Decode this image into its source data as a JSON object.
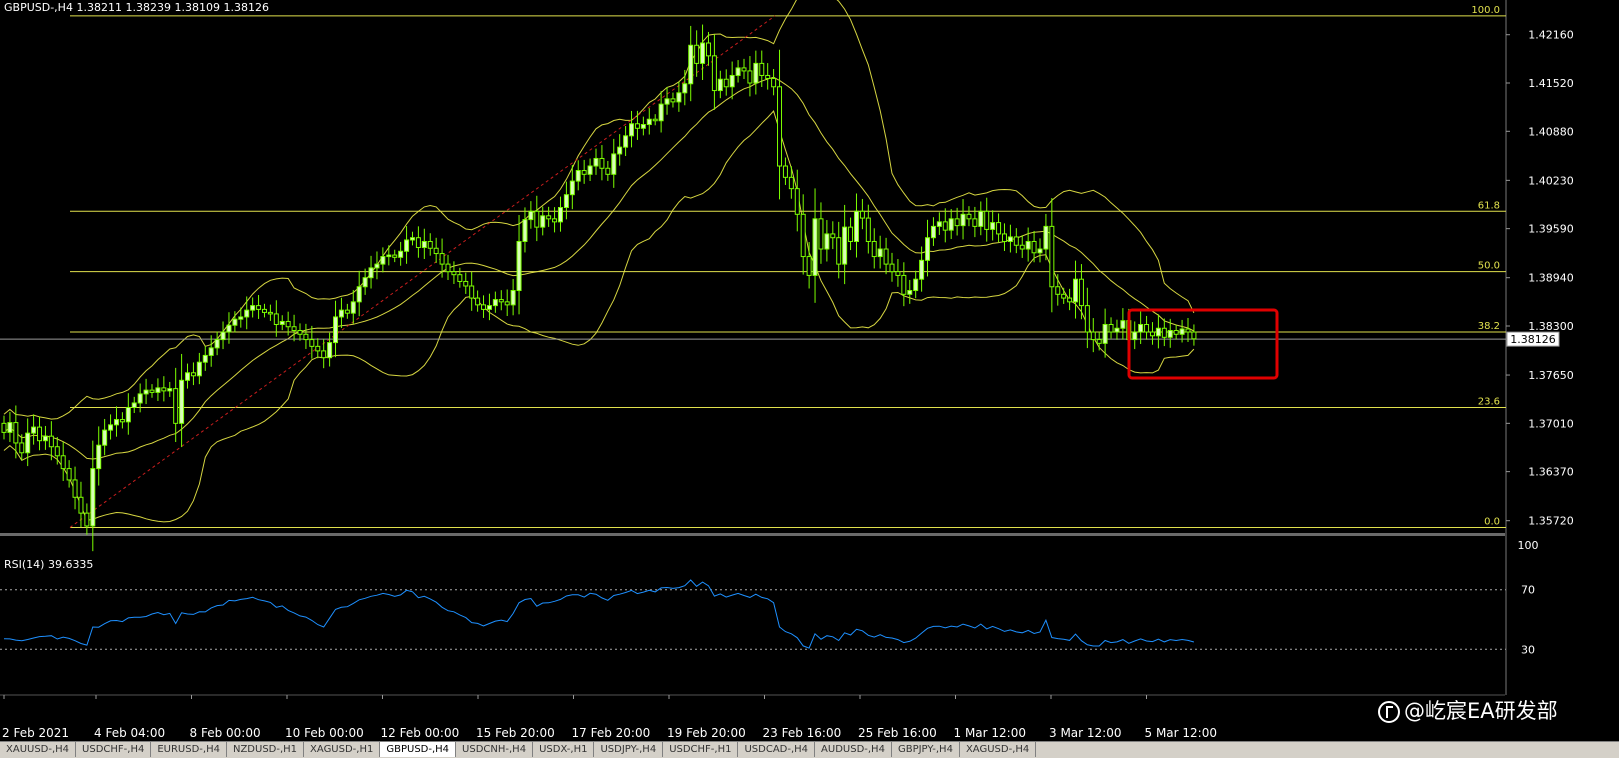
{
  "chart_data": {
    "type": "candlestick",
    "header": {
      "symbol": "GBPUSD-,H4",
      "open": "1.38211",
      "high": "1.38239",
      "low": "1.38109",
      "close": "1.38126"
    },
    "price_axis": {
      "ticks": [
        "1.42160",
        "1.41520",
        "1.40880",
        "1.40230",
        "1.39590",
        "1.38940",
        "1.38300",
        "1.37650",
        "1.37010",
        "1.36370",
        "1.35720"
      ],
      "range": [
        1.3557,
        1.4262
      ],
      "current_price_label": "1.38126"
    },
    "time_axis": {
      "labels": [
        "2 Feb 2021",
        "4 Feb 04:00",
        "8 Feb 00:00",
        "10 Feb 00:00",
        "12 Feb 00:00",
        "15 Feb 20:00",
        "17 Feb 20:00",
        "19 Feb 20:00",
        "23 Feb 16:00",
        "25 Feb 16:00",
        "1 Mar 12:00",
        "3 Mar 12:00",
        "5 Mar 12:00"
      ]
    },
    "fibonacci": [
      {
        "level": "100.0",
        "price": 1.4241
      },
      {
        "level": "61.8",
        "price": 1.3982
      },
      {
        "level": "50.0",
        "price": 1.3902
      },
      {
        "level": "38.2",
        "price": 1.3822
      },
      {
        "level": "23.6",
        "price": 1.3722
      },
      {
        "level": "0.0",
        "price": 1.3563
      }
    ],
    "closes": [
      1.3689,
      1.3702,
      1.3675,
      1.3662,
      1.3688,
      1.3696,
      1.3678,
      1.3684,
      1.367,
      1.3658,
      1.3641,
      1.3626,
      1.3603,
      1.3582,
      1.3565,
      1.3641,
      1.3672,
      1.3692,
      1.3699,
      1.3706,
      1.3703,
      1.3722,
      1.3728,
      1.374,
      1.3745,
      1.3742,
      1.3748,
      1.3744,
      1.3747,
      1.3701,
      1.3758,
      1.3768,
      1.3764,
      1.3782,
      1.3791,
      1.3801,
      1.3812,
      1.3822,
      1.3831,
      1.3839,
      1.3842,
      1.3851,
      1.3857,
      1.3852,
      1.3848,
      1.3846,
      1.3832,
      1.3836,
      1.3829,
      1.3824,
      1.3819,
      1.3812,
      1.3803,
      1.3797,
      1.3788,
      1.3808,
      1.3842,
      1.3851,
      1.3847,
      1.3862,
      1.3882,
      1.3894,
      1.3907,
      1.3912,
      1.3922,
      1.3924,
      1.3921,
      1.3929,
      1.3944,
      1.3947,
      1.3934,
      1.3942,
      1.3933,
      1.3926,
      1.3912,
      1.3902,
      1.3898,
      1.3889,
      1.3883,
      1.3867,
      1.3858,
      1.3852,
      1.3857,
      1.3865,
      1.3862,
      1.3858,
      1.3877,
      1.3942,
      1.3971,
      1.3982,
      1.3961,
      1.3976,
      1.3972,
      1.3968,
      1.3987,
      1.4004,
      1.4022,
      1.4036,
      1.4031,
      1.4042,
      1.4052,
      1.4039,
      1.4031,
      1.4058,
      1.4067,
      1.4082,
      1.4098,
      1.4092,
      1.4097,
      1.4104,
      1.4102,
      1.4124,
      1.4131,
      1.4127,
      1.4139,
      1.4151,
      1.4202,
      1.4178,
      1.4205,
      1.4188,
      1.4142,
      1.4157,
      1.4147,
      1.4162,
      1.4172,
      1.4168,
      1.4152,
      1.4178,
      1.4162,
      1.4158,
      1.4147,
      1.4042,
      1.4027,
      1.4012,
      1.3978,
      1.3922,
      1.3897,
      1.3972,
      1.3932,
      1.3952,
      1.3947,
      1.3912,
      1.3961,
      1.3942,
      1.3982,
      1.3973,
      1.3942,
      1.3922,
      1.3932,
      1.3912,
      1.3902,
      1.3897,
      1.3872,
      1.3877,
      1.3892,
      1.3917,
      1.3947,
      1.3962,
      1.3968,
      1.3957,
      1.3972,
      1.3963,
      1.3978,
      1.3972,
      1.3962,
      1.3982,
      1.3958,
      1.3967,
      1.3952,
      1.3942,
      1.3948,
      1.3937,
      1.3932,
      1.3942,
      1.3927,
      1.3932,
      1.3962,
      1.3882,
      1.3872,
      1.3867,
      1.3862,
      1.3892,
      1.3857,
      1.3822,
      1.3812,
      1.3807,
      1.3832,
      1.3822,
      1.3827,
      1.3837,
      1.3812,
      1.3822,
      1.3832,
      1.3822,
      1.3817,
      1.3827,
      1.3815,
      1.3824,
      1.3819,
      1.3826,
      1.3822,
      1.3813
    ],
    "rsi": {
      "label": "RSI(14) 39.6335",
      "levels": [
        "100",
        "70",
        "30"
      ],
      "range": [
        0,
        100
      ],
      "dashed_levels": [
        70,
        30
      ],
      "values": [
        37.1,
        37.0,
        36.2,
        35.7,
        36.6,
        37.6,
        38.5,
        38.7,
        39.1,
        36.9,
        38.2,
        37.3,
        35.8,
        33.9,
        32.8,
        45.0,
        44.8,
        47.2,
        49.1,
        49.3,
        48.6,
        51.1,
        51.5,
        51.5,
        52.0,
        53.7,
        54.7,
        53.2,
        54.1,
        47.3,
        54.5,
        53.7,
        53.4,
        55.2,
        55.1,
        57.8,
        59.3,
        59.7,
        62.8,
        62.5,
        63.5,
        64.0,
        64.9,
        63.3,
        62.5,
        61.5,
        58.2,
        59.1,
        56.1,
        54.4,
        52.4,
        51.6,
        49.4,
        46.6,
        45.0,
        50.9,
        56.8,
        58.2,
        58.6,
        60.8,
        63.2,
        64.2,
        65.6,
        66.3,
        67.5,
        66.8,
        65.5,
        66.5,
        69.6,
        68.6,
        64.6,
        65.6,
        63.8,
        61.6,
        58.2,
        55.9,
        55.2,
        53.1,
        51.3,
        47.9,
        47.4,
        45.7,
        47.3,
        48.9,
        49.6,
        48.6,
        54.0,
        61.2,
        63.4,
        64.1,
        58.9,
        61.1,
        61.2,
        62.2,
        63.5,
        65.8,
        66.6,
        66.6,
        65.0,
        67.6,
        67.0,
        64.5,
        62.9,
        66.1,
        67.0,
        68.1,
        69.5,
        67.4,
        68.4,
        69.6,
        68.5,
        71.2,
        71.5,
        70.9,
        71.4,
        72.7,
        76.5,
        72.3,
        75.1,
        72.6,
        65.7,
        67.2,
        65.0,
        66.4,
        67.5,
        66.1,
        64.8,
        67.0,
        64.8,
        63.9,
        61.3,
        45.0,
        41.9,
        40.4,
        37.7,
        32.3,
        30.8,
        40.4,
        36.8,
        39.1,
        38.4,
        35.9,
        41.1,
        39.6,
        43.4,
        42.4,
        39.4,
        38.2,
        39.8,
        38.0,
        37.6,
        36.5,
        34.5,
        35.4,
        37.5,
        40.9,
        44.1,
        45.4,
        45.5,
        44.4,
        45.6,
        45.0,
        46.9,
        45.7,
        44.3,
        46.9,
        43.7,
        45.4,
        43.8,
        42.0,
        43.0,
        41.7,
        41.1,
        42.7,
        40.6,
        41.6,
        49.5,
        37.9,
        37.2,
        36.7,
        36.0,
        40.2,
        35.8,
        33.0,
        32.2,
        32.2,
        35.9,
        34.5,
        35.0,
        36.5,
        34.0,
        35.6,
        37.0,
        35.6,
        35.2,
        36.8,
        35.0,
        36.5,
        35.9,
        36.6,
        36.0,
        34.9
      ]
    }
  },
  "colors": {
    "background": "#000000",
    "bull_candle": "#d8ffb8",
    "bear_candle": "#000000",
    "candle_wick": "#7cff00",
    "bollinger": "#d6d641",
    "fibonacci": "#e1e14d",
    "trendline": "#c81e1e",
    "rsi_line": "#1e90ff",
    "highlight_box": "#e00000",
    "axis_text": "#ffffff"
  },
  "tabs": [
    "XAUUSD-,H4",
    "USDCHF-,H4",
    "EURUSD-,H4",
    "NZDUSD-,H1",
    "XAGUSD-,H1",
    "GBPUSD-,H4",
    "USDCNH-,H4",
    "USDX-,H1",
    "USDJPY-,H4",
    "USDCHF-,H1",
    "USDCAD-,H4",
    "AUDUSD-,H4",
    "GBPJPY-,H4",
    "XAGUSD-,H4"
  ],
  "active_tab": "GBPUSD-,H4",
  "watermark": "@屹宸EA研发部"
}
